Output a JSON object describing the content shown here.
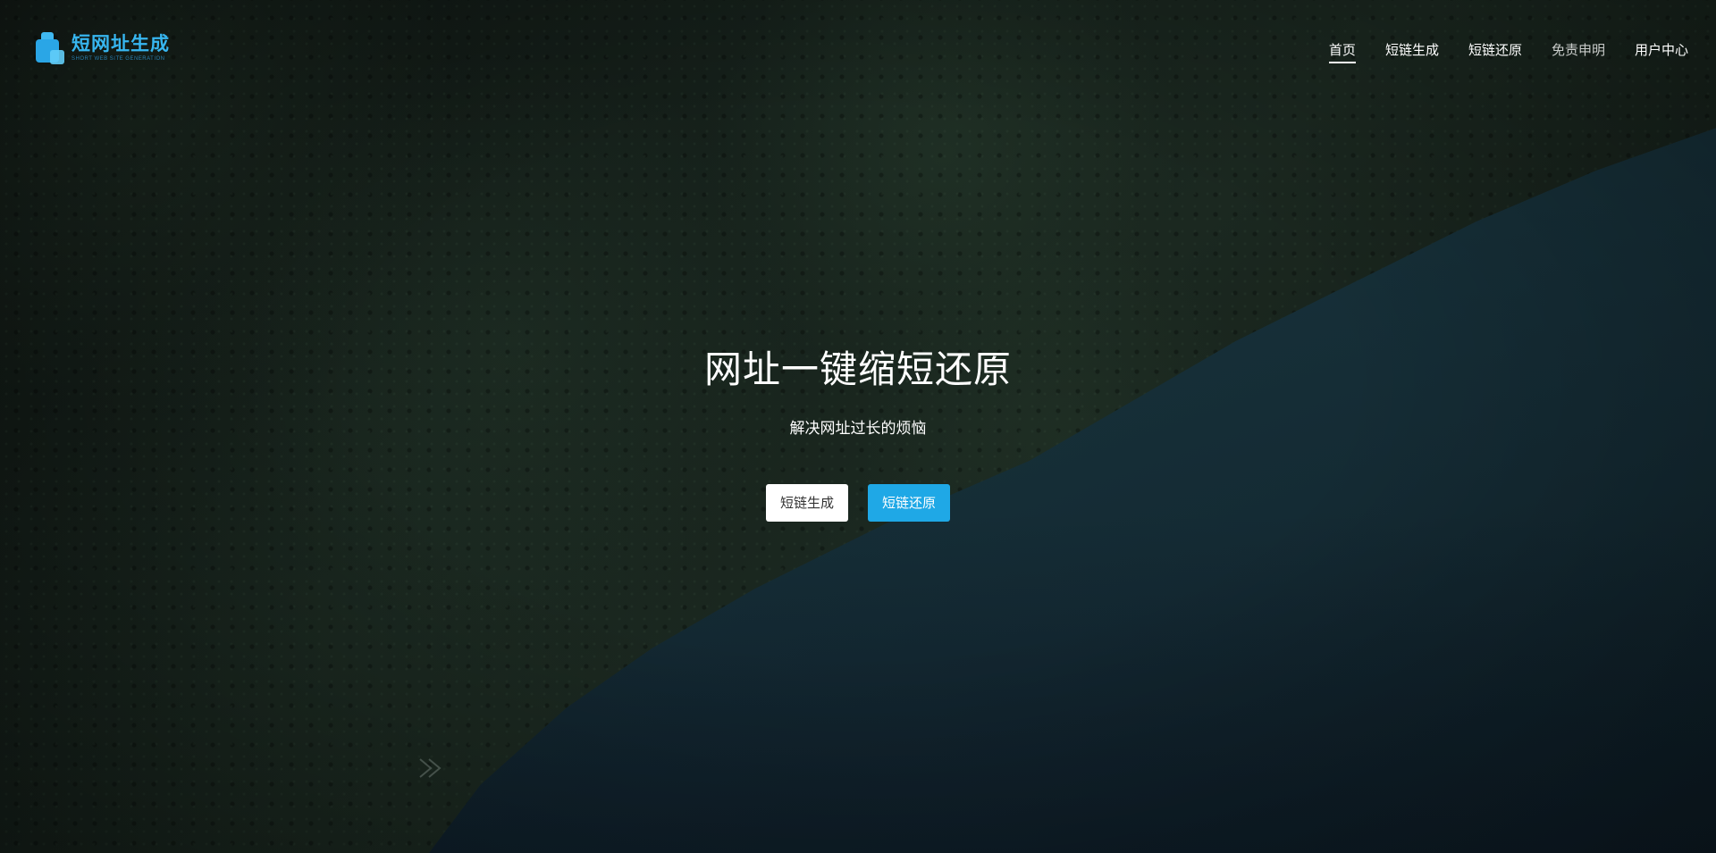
{
  "header": {
    "logo": {
      "title": "短网址生成",
      "subtitle": "SHORT WEB SITE GENERATION"
    },
    "nav": [
      {
        "label": "首页",
        "active": true
      },
      {
        "label": "短链生成",
        "active": false
      },
      {
        "label": "短链还原",
        "active": false
      },
      {
        "label": "免责申明",
        "active": false
      },
      {
        "label": "用户中心",
        "active": false
      }
    ]
  },
  "hero": {
    "headline": "网址一键缩短还原",
    "subline": "解决网址过长的烦恼",
    "buttons": {
      "generate": "短链生成",
      "restore": "短链还原"
    }
  },
  "colors": {
    "brand": "#37b6f0",
    "primary_button": "#1fa8e6",
    "secondary_button": "#ffffff"
  }
}
